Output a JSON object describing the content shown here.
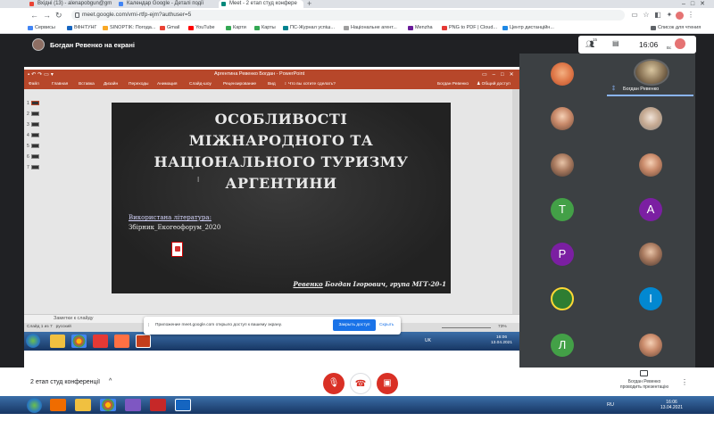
{
  "browser": {
    "tabs": [
      {
        "label": "Вхідні (13) - alenapobgun@gm"
      },
      {
        "label": "Календар Google - Деталі події"
      },
      {
        "label": "Meet - 2 етап студ конфере"
      }
    ],
    "url": "meet.google.com/vmi-rtfp-ejm?authuser=5",
    "bookmarks": [
      {
        "label": "Сервисы"
      },
      {
        "label": "ВФНТУНГ"
      },
      {
        "label": "SINOPTIK: Погода..."
      },
      {
        "label": "Gmail"
      },
      {
        "label": "YouTube"
      },
      {
        "label": "Карти"
      },
      {
        "label": "Карты"
      },
      {
        "label": "ПС-Журнал успіш..."
      },
      {
        "label": "Національне агент..."
      },
      {
        "label": "Menzha"
      },
      {
        "label": "PNG to PDF | Cloud..."
      },
      {
        "label": "Центр дистанційн..."
      }
    ],
    "reading_list": "Список для чтения"
  },
  "meet": {
    "presenter_label": "Богдан Ревенко на екрані",
    "people_count": "15",
    "clock": "16:06",
    "self_initials": "Вс",
    "meeting_name": "2 етап студ конференції",
    "presenter_tile_name": "Богдан Ревенко",
    "presenting_label_line1": "Богдан Ревенко",
    "presenting_label_line2": "проводить презентацію",
    "participants": [
      {
        "kind": "photo-red",
        "letter": ""
      },
      {
        "kind": "photo",
        "letter": ""
      },
      {
        "kind": "photo2",
        "letter": ""
      },
      {
        "kind": "photo3",
        "letter": ""
      },
      {
        "kind": "photo",
        "letter": ""
      },
      {
        "kind": "initial",
        "letter": "T",
        "color": "#43a047"
      },
      {
        "kind": "initial",
        "letter": "A",
        "color": "#7b1fa2"
      },
      {
        "kind": "initial",
        "letter": "P",
        "color": "#7b1fa2"
      },
      {
        "kind": "photo2",
        "letter": ""
      },
      {
        "kind": "initial",
        "letter": "",
        "color": "#2e7d32"
      },
      {
        "kind": "initial",
        "letter": "I",
        "color": "#0288d1"
      },
      {
        "kind": "initial",
        "letter": "Л",
        "color": "#43a047"
      },
      {
        "kind": "photo",
        "letter": ""
      }
    ]
  },
  "powerpoint": {
    "window_title": "Аргентина Ревенко Богдан - PowerPoint",
    "ribbon_tabs": [
      "Файл",
      "Главная",
      "Вставка",
      "Дизайн",
      "Переходы",
      "Анимация",
      "Слайд-шоу",
      "Рецензирование",
      "Вид"
    ],
    "tell_me": "Что вы хотите сделать?",
    "user": "Богдан Ревенко",
    "share": "Общий доступ",
    "slide_numbers": [
      "1",
      "2",
      "3",
      "4",
      "5",
      "6",
      "7"
    ],
    "slide": {
      "title_lines": [
        "ОСОБЛИВОСТІ",
        "МІЖНАРОДНОГО ТА",
        "НАЦІОНАЛЬНОГО ТУРИЗМУ",
        "АРГЕНТИНИ"
      ],
      "literature_label": "Використана література:",
      "literature_file": "Збірник_Екогеофорум_2020",
      "author_underlined": "Ревенко",
      "author_rest": " Богдан Ігорович, група МГТ-20-1"
    },
    "notes_label": "Заметки к слайду",
    "status_left": "Слайд 1 из 7",
    "status_lang": "русский",
    "zoom": "73%",
    "inner_tray": "UK",
    "inner_time": "16:06",
    "inner_date": "13.04.2021"
  },
  "toast": {
    "text": "Приложение meet.google.com открыло доступ к вашему экрану.",
    "stop": "Закрыть доступ",
    "hide": "Скрыть"
  },
  "taskbar": {
    "tray": "RU",
    "time": "16:06",
    "date": "13.04.2021"
  },
  "colors": {
    "ppt_accent": "#b7472a",
    "meet_bg": "#202124",
    "danger": "#d93025"
  }
}
